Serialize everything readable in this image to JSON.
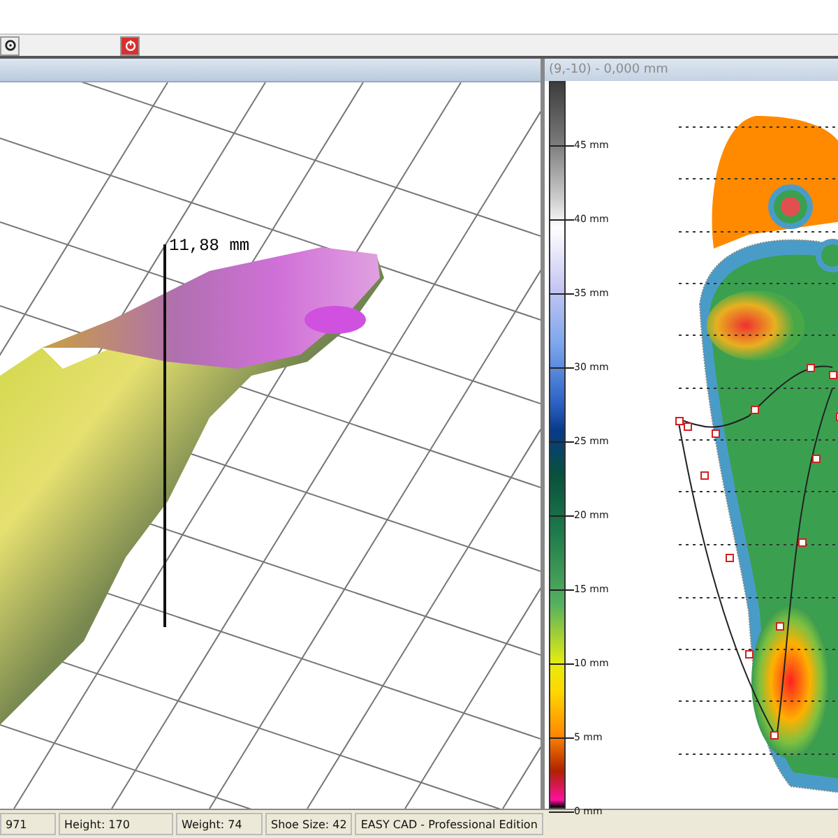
{
  "left_view": {
    "measurement": "11,88 mm"
  },
  "right_view": {
    "header": "(9,-10) - 0,000 mm",
    "legend": [
      "45 mm",
      "40 mm",
      "35 mm",
      "30 mm",
      "25 mm",
      "20 mm",
      "15 mm",
      "10 mm",
      "5 mm",
      "0 mm"
    ]
  },
  "status_bar": [
    "971",
    "Height: 170",
    "Weight: 74",
    "Shoe Size: 42",
    "EASY CAD - Professional Edition"
  ]
}
